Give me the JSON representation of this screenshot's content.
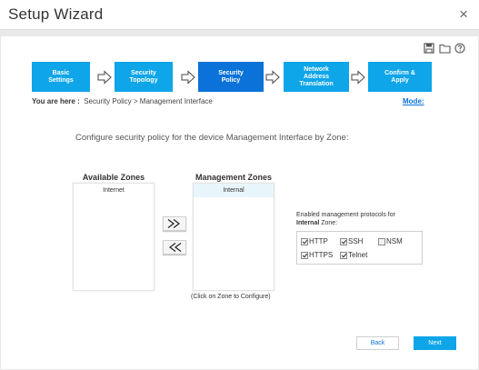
{
  "window": {
    "title": "Setup Wizard",
    "close_glyph": "×"
  },
  "toolbar": {
    "icons": [
      "save-icon",
      "folder-icon",
      "help-icon"
    ]
  },
  "steps": [
    {
      "label": "Basic\nSettings"
    },
    {
      "label": "Security\nTopology"
    },
    {
      "label": "Security\nPolicy"
    },
    {
      "label": "Network\nAddress\nTranslation"
    },
    {
      "label": "Confirm &\nApply"
    }
  ],
  "active_step_index": 2,
  "breadcrumb": {
    "prefix": "You are here :",
    "path": "Security Policy > Management Interface"
  },
  "mode_label": "Mode:",
  "instruction": "Configure security policy for the device Management Interface by Zone:",
  "available_zones": {
    "heading": "Available Zones",
    "items": [
      "Internet"
    ]
  },
  "management_zones": {
    "heading": "Management Zones",
    "items": [
      "Internal"
    ]
  },
  "move_right_glyph": "»",
  "move_left_glyph": "«",
  "click_hint": "(Click on Zone to Configure)",
  "protocols_label": {
    "line1": "Enabled management protocols for",
    "zone": "Internal",
    "suffix": "Zone:"
  },
  "protocols": [
    {
      "label": "HTTP",
      "checked": true
    },
    {
      "label": "SSH",
      "checked": true
    },
    {
      "label": "NSM",
      "checked": false
    },
    {
      "label": "HTTPS",
      "checked": true
    },
    {
      "label": "Telnet",
      "checked": true
    }
  ],
  "buttons": {
    "back": "Back",
    "next": "Next"
  },
  "colors": {
    "step": "#0ea5e9",
    "step_active": "#0a72d8",
    "link": "#0a72d8"
  }
}
